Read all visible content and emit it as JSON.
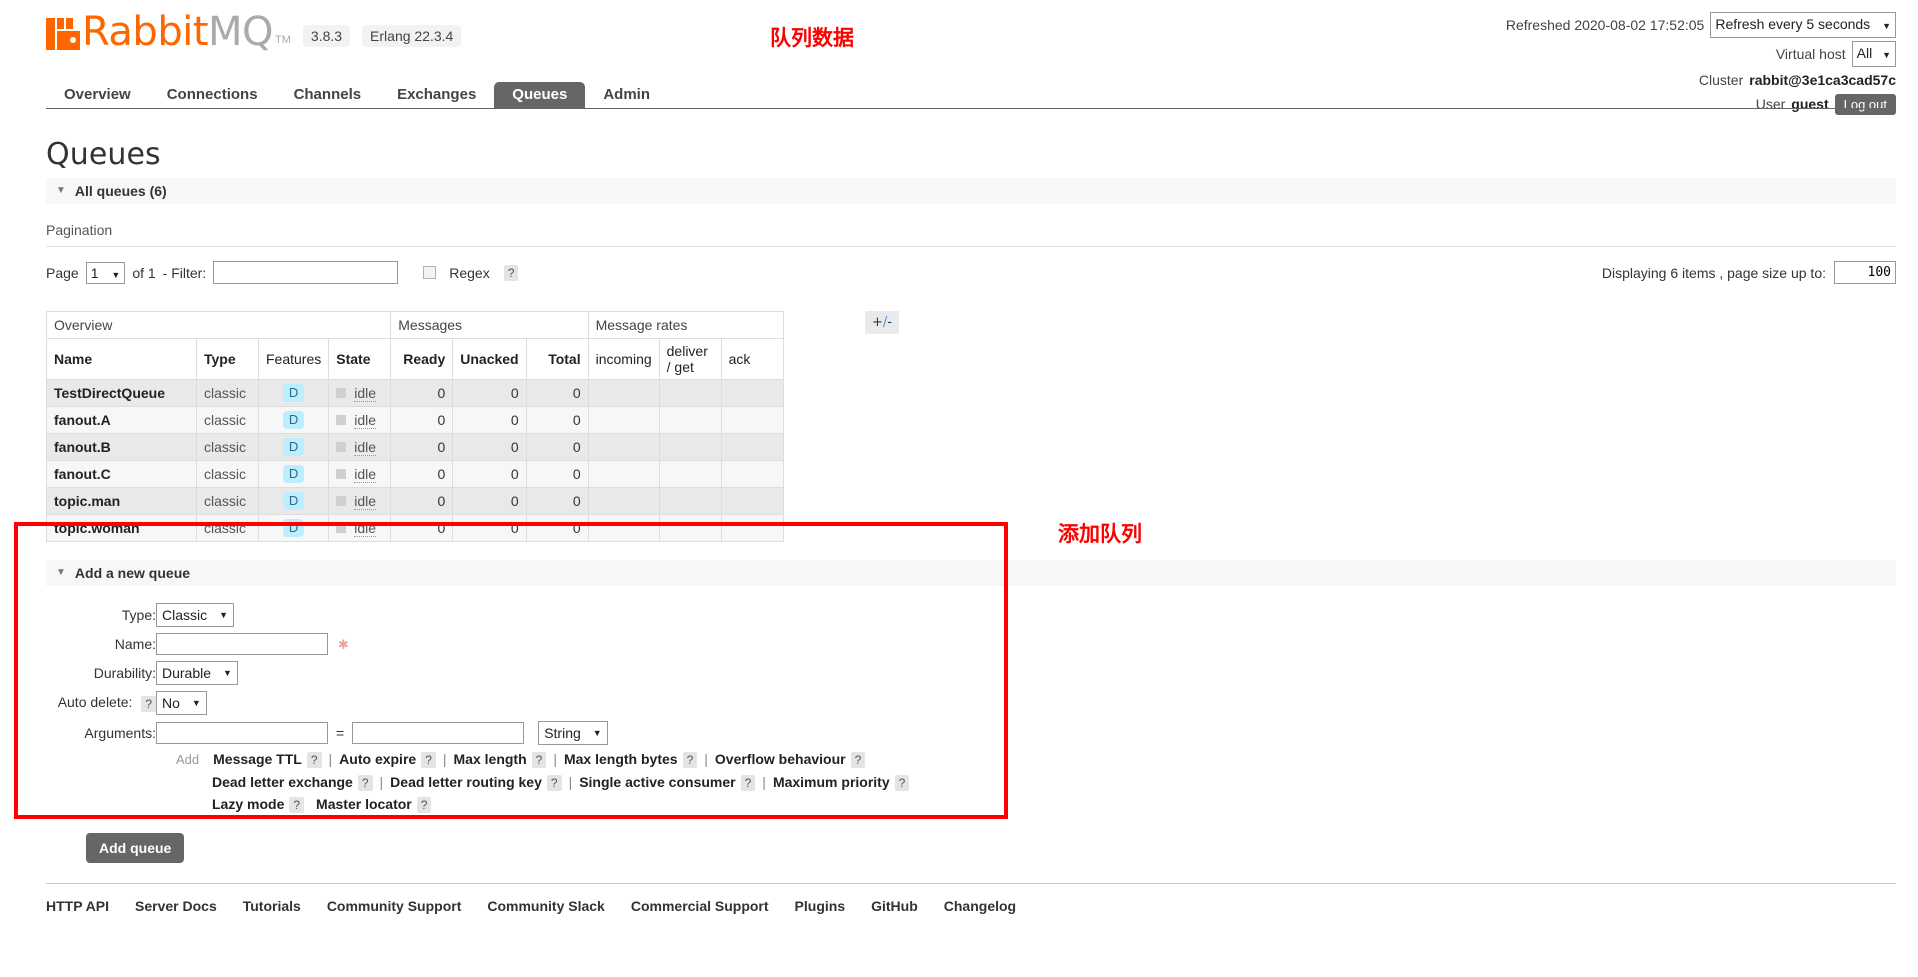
{
  "brand": {
    "name_part1": "Rabbit",
    "name_part2": "MQ",
    "tm": "TM",
    "version": "3.8.3",
    "erlang": "Erlang 22.3.4"
  },
  "header": {
    "refreshed_label": "Refreshed 2020-08-02 17:52:05",
    "refresh_interval": "Refresh every 5 seconds",
    "vhost_label": "Virtual host",
    "vhost_value": "All",
    "cluster_label": "Cluster",
    "cluster_value": "rabbit@3e1ca3cad57c",
    "user_label": "User",
    "user_value": "guest",
    "logout_label": "Log out"
  },
  "nav": {
    "tabs": [
      {
        "label": "Overview",
        "active": false
      },
      {
        "label": "Connections",
        "active": false
      },
      {
        "label": "Channels",
        "active": false
      },
      {
        "label": "Exchanges",
        "active": false
      },
      {
        "label": "Queues",
        "active": true
      },
      {
        "label": "Admin",
        "active": false
      }
    ]
  },
  "page": {
    "title": "Queues",
    "all_queues_label": "All queues (6)",
    "pagination_caption": "Pagination"
  },
  "pagination": {
    "page_label": "Page",
    "page_value": "1",
    "of_label": "of 1",
    "filter_label": "- Filter:",
    "filter_value": "",
    "regex_label": "Regex",
    "help": "?",
    "displaying_label": "Displaying 6 items , page size up to:",
    "page_size": "100"
  },
  "table": {
    "groups": [
      {
        "label": "Overview",
        "span": 4
      },
      {
        "label": "Messages",
        "span": 3
      },
      {
        "label": "Message rates",
        "span": 3
      }
    ],
    "plusminus": "+/-",
    "columns": [
      "Name",
      "Type",
      "Features",
      "State",
      "Ready",
      "Unacked",
      "Total",
      "incoming",
      "deliver / get",
      "ack"
    ],
    "rows": [
      {
        "name": "TestDirectQueue",
        "type": "classic",
        "features": "D",
        "state": "idle",
        "ready": "0",
        "unacked": "0",
        "total": "0",
        "incoming": "",
        "deliver_get": "",
        "ack": ""
      },
      {
        "name": "fanout.A",
        "type": "classic",
        "features": "D",
        "state": "idle",
        "ready": "0",
        "unacked": "0",
        "total": "0",
        "incoming": "",
        "deliver_get": "",
        "ack": ""
      },
      {
        "name": "fanout.B",
        "type": "classic",
        "features": "D",
        "state": "idle",
        "ready": "0",
        "unacked": "0",
        "total": "0",
        "incoming": "",
        "deliver_get": "",
        "ack": ""
      },
      {
        "name": "fanout.C",
        "type": "classic",
        "features": "D",
        "state": "idle",
        "ready": "0",
        "unacked": "0",
        "total": "0",
        "incoming": "",
        "deliver_get": "",
        "ack": ""
      },
      {
        "name": "topic.man",
        "type": "classic",
        "features": "D",
        "state": "idle",
        "ready": "0",
        "unacked": "0",
        "total": "0",
        "incoming": "",
        "deliver_get": "",
        "ack": ""
      },
      {
        "name": "topic.woman",
        "type": "classic",
        "features": "D",
        "state": "idle",
        "ready": "0",
        "unacked": "0",
        "total": "0",
        "incoming": "",
        "deliver_get": "",
        "ack": ""
      }
    ]
  },
  "add_queue": {
    "section_label": "Add a new queue",
    "type_label": "Type:",
    "type_value": "Classic",
    "name_label": "Name:",
    "name_value": "",
    "durability_label": "Durability:",
    "durability_value": "Durable",
    "autodelete_label": "Auto delete:",
    "autodelete_value": "No",
    "arguments_label": "Arguments:",
    "arg_key": "",
    "arg_value": "",
    "arg_type": "String",
    "equals": "=",
    "add_label": "Add",
    "arg_presets_row1": [
      "Message TTL",
      "Auto expire",
      "Max length",
      "Max length bytes",
      "Overflow behaviour"
    ],
    "arg_presets_row2": [
      "Dead letter exchange",
      "Dead letter routing key",
      "Single active consumer",
      "Maximum priority"
    ],
    "arg_presets_row3": [
      "Lazy mode",
      "Master locator"
    ],
    "submit_label": "Add queue",
    "help": "?"
  },
  "footer": {
    "links": [
      "HTTP API",
      "Server Docs",
      "Tutorials",
      "Community Support",
      "Community Slack",
      "Commercial Support",
      "Plugins",
      "GitHub",
      "Changelog"
    ]
  },
  "annotations": {
    "note_queue_data": "队列数据",
    "note_add_queue": "添加队列",
    "color": "#ff0000"
  }
}
